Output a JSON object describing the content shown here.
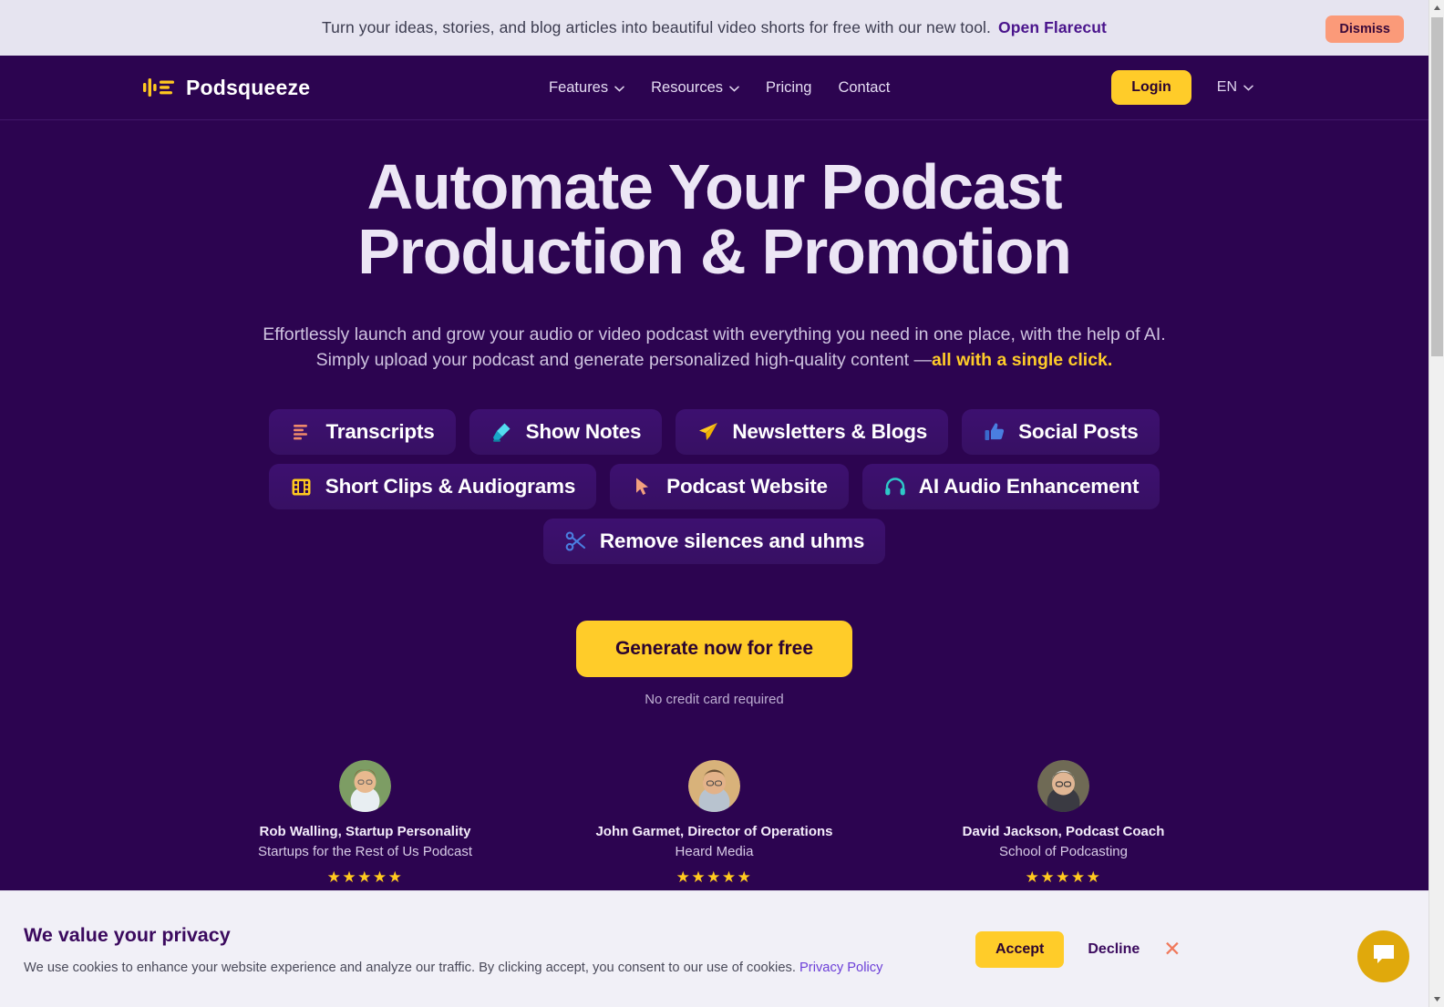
{
  "promo": {
    "text": "Turn your ideas, stories, and blog articles into beautiful video shorts for free with our new tool.",
    "link_label": "Open Flarecut",
    "dismiss_label": "Dismiss"
  },
  "nav": {
    "brand": "Podsqueeze",
    "links": [
      {
        "label": "Features",
        "has_caret": true
      },
      {
        "label": "Resources",
        "has_caret": true
      },
      {
        "label": "Pricing",
        "has_caret": false
      },
      {
        "label": "Contact",
        "has_caret": false
      }
    ],
    "login_label": "Login",
    "language": "EN"
  },
  "hero": {
    "title_line1": "Automate Your Podcast",
    "title_line2": "Production & Promotion",
    "sub_line1": "Effortlessly launch and grow your audio or video podcast with everything you need in one place, with the help of AI.",
    "sub_line2_plain": "Simply upload your podcast and generate personalized high-quality content —",
    "sub_line2_highlight": "all with a single click.",
    "cta_label": "Generate now for free",
    "cta_note": "No credit card required"
  },
  "features": {
    "row1": [
      {
        "label": "Transcripts",
        "icon": "transcript-lines-icon",
        "color": "#f08a6a"
      },
      {
        "label": "Show Notes",
        "icon": "highlighter-pen-icon",
        "color": "#2ec8e6"
      },
      {
        "label": "Newsletters & Blogs",
        "icon": "paper-plane-icon",
        "color": "#ffc91f"
      },
      {
        "label": "Social Posts",
        "icon": "thumbs-up-icon",
        "color": "#4a7ee0"
      }
    ],
    "row2": [
      {
        "label": "Short Clips & Audiograms",
        "icon": "film-strip-icon",
        "color": "#ffc91f"
      },
      {
        "label": "Podcast Website",
        "icon": "cursor-arrow-icon",
        "color": "#f2a07e"
      },
      {
        "label": "AI Audio Enhancement",
        "icon": "headphones-icon",
        "color": "#2ec8c8"
      }
    ],
    "row3": [
      {
        "label": "Remove silences and uhms",
        "icon": "scissors-icon",
        "color": "#4a7ee0"
      }
    ]
  },
  "testimonials": [
    {
      "name": "Rob Walling, Startup Personality",
      "org": "Startups for the Rest of Us Podcast",
      "stars": "★★★★★",
      "rating": 5,
      "avatar_tone": "#7d9d64"
    },
    {
      "name": "John Garmet, Director of Operations",
      "org": "Heard Media",
      "stars": "★★★★★",
      "rating": 5,
      "avatar_tone": "#d8b27a"
    },
    {
      "name": "David Jackson, Podcast Coach",
      "org": "School of Podcasting",
      "stars": "★★★★★",
      "rating": 5,
      "avatar_tone": "#6f6a55"
    }
  ],
  "cookie": {
    "title": "We value your privacy",
    "body": "We use cookies to enhance your website experience and analyze our traffic. By clicking accept, you consent to our use of cookies.",
    "policy_label": "Privacy Policy",
    "accept_label": "Accept",
    "decline_label": "Decline",
    "close_label": "✕"
  },
  "colors": {
    "page_bg": "#2c0450",
    "accent_yellow": "#ffcc29",
    "promo_bg": "#e6e4f0",
    "pill_bg": "#3d1070",
    "chat_fab": "#e0a90c"
  }
}
